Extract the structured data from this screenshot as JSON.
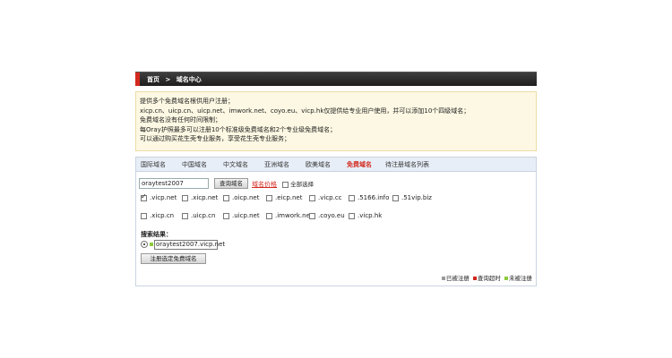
{
  "breadcrumb": {
    "home": "首页",
    "separator": ">",
    "current": "域名中心"
  },
  "notice": [
    "提供多个免费域名根供用户注册；",
    "xicp.cn、uicp.cn、uicp.net、imwork.net、coyo.eu、vicp.hk仅提供给专业用户使用，并可以添加10个四级域名；",
    "免费域名没有任何时间限制；",
    "每Oray护照最多可以注册10个标准级免费域名和2个专业级免费域名；",
    "可以通过购买花生壳专业服务，享受花生壳专业服务；"
  ],
  "tabs": [
    {
      "label": "国际域名",
      "active": false
    },
    {
      "label": "中国域名",
      "active": false
    },
    {
      "label": "中文域名",
      "active": false
    },
    {
      "label": "亚洲域名",
      "active": false
    },
    {
      "label": "欧美域名",
      "active": false
    },
    {
      "label": "免费域名",
      "active": true
    },
    {
      "label": "待注册域名列表",
      "active": false
    }
  ],
  "search": {
    "value": "oraytest2007",
    "button": "查询域名",
    "price_link": "域名价格",
    "select_all": "全部选择"
  },
  "domain_options": [
    {
      "label": ".vicp.net",
      "checked": true
    },
    {
      "label": ".xicp.net",
      "checked": false
    },
    {
      "label": ".oicp.net",
      "checked": false
    },
    {
      "label": ".eicp.net",
      "checked": false
    },
    {
      "label": ".vicp.cc",
      "checked": false
    },
    {
      "label": ".5166.info",
      "checked": false
    },
    {
      "label": ".51vip.biz",
      "checked": false
    },
    {
      "label": ".xicp.cn",
      "checked": false
    },
    {
      "label": ".uicp.cn",
      "checked": false
    },
    {
      "label": ".uicp.net",
      "checked": false
    },
    {
      "label": ".imwork.net",
      "checked": false
    },
    {
      "label": ".coyo.eu",
      "checked": false
    },
    {
      "label": ".vicp.hk",
      "checked": false
    }
  ],
  "results": {
    "label": "搜索结果：",
    "item": "oraytest2007.vicp.net",
    "register_button": "注册选定免费域名"
  },
  "legend": [
    {
      "label": "已被注册",
      "color": "#999999"
    },
    {
      "label": "查询超时",
      "color": "#d2261c"
    },
    {
      "label": "未被注册",
      "color": "#8ccb3c"
    }
  ]
}
